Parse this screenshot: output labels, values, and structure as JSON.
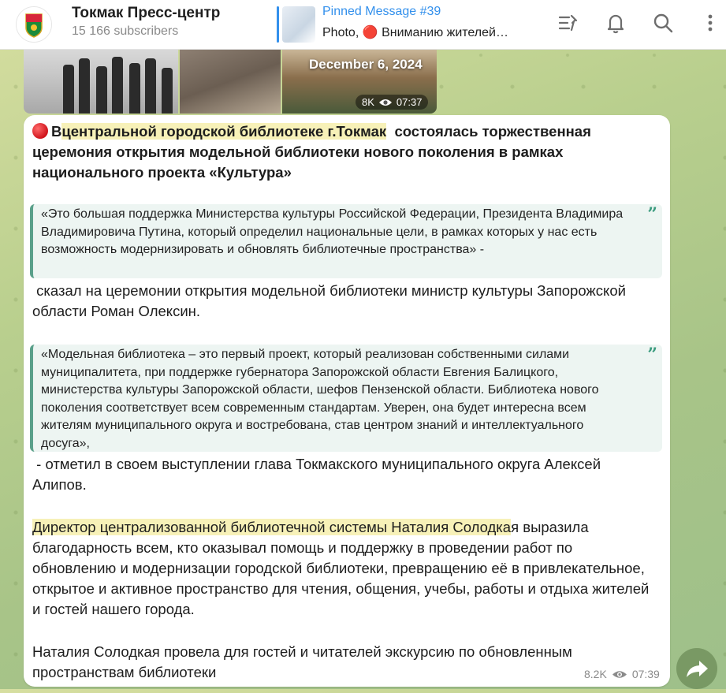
{
  "channel": {
    "title": "Токмак Пресс-центр",
    "subscribers": "15 166 subscribers"
  },
  "pinned": {
    "title": "Pinned Message #39",
    "preview": "Photo, 🔴 Вниманию жителей…"
  },
  "media": {
    "date": "December 6, 2024",
    "views": "8K",
    "time": "07:37"
  },
  "post": {
    "p1_lead": "В",
    "p1_highlight": "центральной городской библиотеке г.Токмак",
    "p1_rest": "состоялась торжественная церемония открытия модельной библиотеки нового поколения в рамках национального проекта «Культура»",
    "quote1": "«Это большая поддержка Министерства культуры Российской Федерации, Президента Владимира Владимировича Путина, который определил национальные цели, в рамках которых у нас есть возможность модернизировать и обновлять библиотечные пространства» -",
    "after_quote1": "сказал на церемонии открытия модельной библиотеки министр культуры Запорожской области Роман Олексин.",
    "quote2": "«Модельная библиотека – это первый проект, который реализован собственными силами муниципалитета, при поддержке губернатора Запорожской области Евгения Балицкого, министерства культуры Запорожской области, шефов Пензенской области. Библиотека нового поколения соответствует всем современным стандартам. Уверен, она будет интересна всем жителям муниципального округа и востребована, став центром знаний и интеллектуального досуга»,",
    "after_quote2": "- отметил в своем выступлении глава Токмакского муниципального округа Алексей Алипов.",
    "director_highlight": "Директор централизованной библиотечной системы Наталия Солодка",
    "director_rest": "я выразила благодарность всем, кто оказывал помощь и поддержку в проведении работ по обновлению и модернизации городской библиотеки,  превращению  её в привлекательное, открытое и активное пространство для чтения, общения, учебы, работы и отдыха жителей и гостей нашего города.",
    "last": "Наталия Солодкая  провела для гостей и читателей экскурсию по обновленным пространствам библиотеки",
    "views": "8.2K",
    "time": "07:39"
  },
  "quote_mark": "”",
  "colors": {
    "accent": "#3390ec",
    "highlight": "#f7f1b8",
    "quote_border": "#5aa08a"
  },
  "icons": [
    "pin-list-icon",
    "bell-icon",
    "search-icon",
    "more-vertical-icon",
    "eye-icon",
    "share-icon"
  ]
}
